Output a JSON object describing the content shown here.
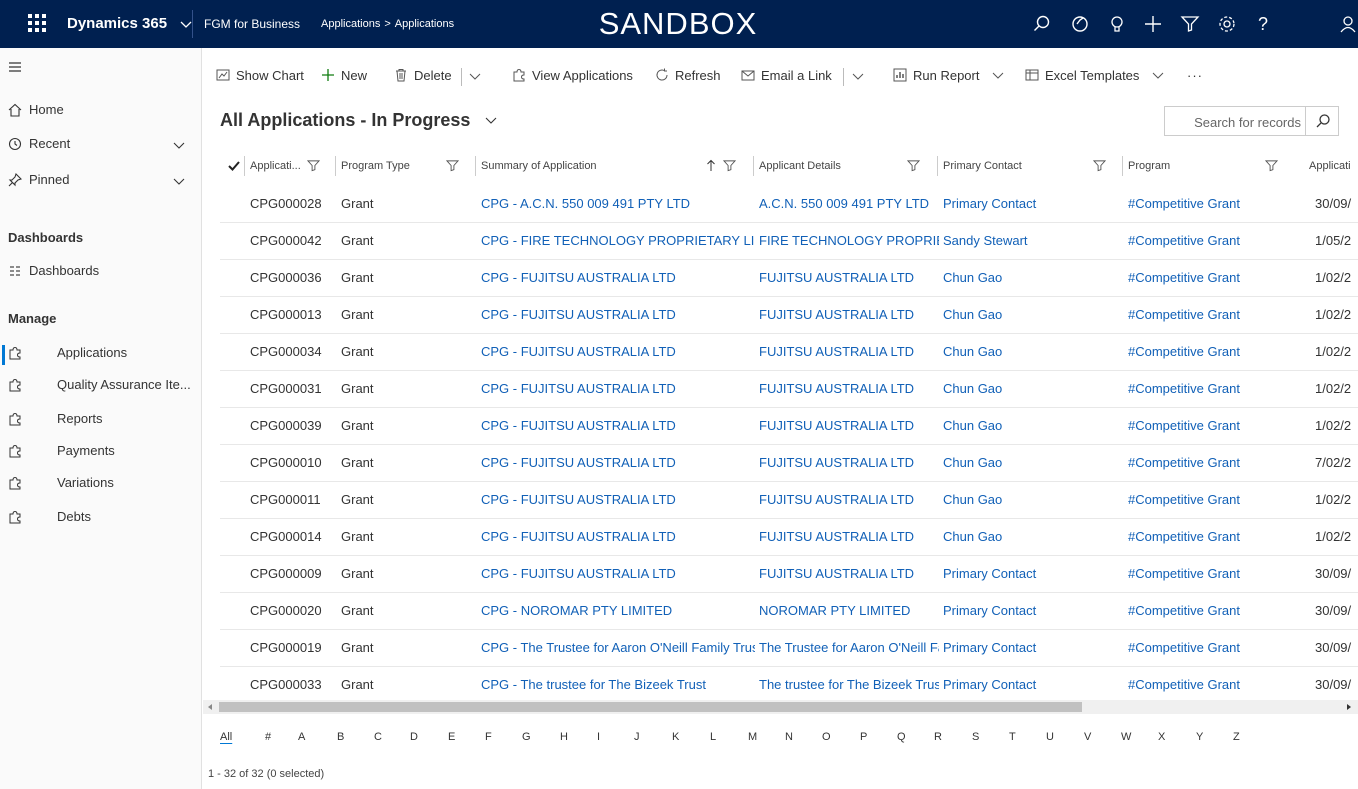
{
  "topbar": {
    "app_name": "Dynamics 365",
    "business_unit": "FGM for Business",
    "breadcrumb": [
      "Applications",
      "Applications"
    ],
    "environment_banner": "SANDBOX",
    "icons": [
      "search-icon",
      "activity-icon",
      "lightbulb-icon",
      "plus-icon",
      "filter-icon",
      "gear-icon",
      "help-icon",
      "user-icon"
    ],
    "background_color": "#002050"
  },
  "sidebar": {
    "top_items": [
      {
        "label": "Home",
        "icon": "home-icon"
      },
      {
        "label": "Recent",
        "icon": "clock-icon",
        "expandable": true
      },
      {
        "label": "Pinned",
        "icon": "pin-icon",
        "expandable": true
      }
    ],
    "sections": [
      {
        "title": "Dashboards",
        "items": [
          {
            "label": "Dashboards",
            "icon": "dashboard-icon"
          }
        ]
      },
      {
        "title": "Manage",
        "items": [
          {
            "label": "Applications",
            "icon": "puzzle-icon",
            "selected": true
          },
          {
            "label": "Quality Assurance Ite...",
            "icon": "puzzle-icon"
          },
          {
            "label": "Reports",
            "icon": "puzzle-icon"
          },
          {
            "label": "Payments",
            "icon": "puzzle-icon"
          },
          {
            "label": "Variations",
            "icon": "puzzle-icon"
          },
          {
            "label": "Debts",
            "icon": "puzzle-icon"
          }
        ]
      }
    ],
    "accent_color": "#0078d4"
  },
  "commands": [
    {
      "label": "Show Chart",
      "icon": "chart-icon"
    },
    {
      "label": "New",
      "icon": "plus-icon"
    },
    {
      "label": "Delete",
      "icon": "trash-icon"
    },
    {
      "label": "View Applications",
      "icon": "puzzle-icon"
    },
    {
      "label": "Refresh",
      "icon": "refresh-icon"
    },
    {
      "label": "Email a Link",
      "icon": "email-icon"
    },
    {
      "label": "Run Report",
      "icon": "report-icon"
    },
    {
      "label": "Excel Templates",
      "icon": "excel-icon"
    },
    {
      "label": "···",
      "icon": "more-icon"
    }
  ],
  "view": {
    "title": "All Applications - In Progress",
    "search_placeholder": "Search for records"
  },
  "grid": {
    "columns": [
      "Applicati...",
      "Program Type",
      "Summary of Application",
      "Applicant Details",
      "Primary Contact",
      "Program",
      "Applicati"
    ],
    "sorted_column": "Summary of Application",
    "sort_direction": "ascending",
    "rows": [
      [
        "CPG000028",
        "Grant",
        "CPG - A.C.N. 550 009 491 PTY LTD",
        "A.C.N. 550 009 491 PTY LTD",
        "Primary Contact",
        "#Competitive Grant",
        "30/09/"
      ],
      [
        "CPG000042",
        "Grant",
        "CPG - FIRE TECHNOLOGY PROPRIETARY LIMITE",
        "FIRE TECHNOLOGY PROPRIETA",
        "Sandy Stewart",
        "#Competitive Grant",
        "1/05/2"
      ],
      [
        "CPG000036",
        "Grant",
        "CPG - FUJITSU AUSTRALIA LTD",
        "FUJITSU AUSTRALIA LTD",
        "Chun Gao",
        "#Competitive Grant",
        "1/02/2"
      ],
      [
        "CPG000013",
        "Grant",
        "CPG - FUJITSU AUSTRALIA LTD",
        "FUJITSU AUSTRALIA LTD",
        "Chun Gao",
        "#Competitive Grant",
        "1/02/2"
      ],
      [
        "CPG000034",
        "Grant",
        "CPG - FUJITSU AUSTRALIA LTD",
        "FUJITSU AUSTRALIA LTD",
        "Chun Gao",
        "#Competitive Grant",
        "1/02/2"
      ],
      [
        "CPG000031",
        "Grant",
        "CPG - FUJITSU AUSTRALIA LTD",
        "FUJITSU AUSTRALIA LTD",
        "Chun Gao",
        "#Competitive Grant",
        "1/02/2"
      ],
      [
        "CPG000039",
        "Grant",
        "CPG - FUJITSU AUSTRALIA LTD",
        "FUJITSU AUSTRALIA LTD",
        "Chun Gao",
        "#Competitive Grant",
        "1/02/2"
      ],
      [
        "CPG000010",
        "Grant",
        "CPG - FUJITSU AUSTRALIA LTD",
        "FUJITSU AUSTRALIA LTD",
        "Chun Gao",
        "#Competitive Grant",
        "7/02/2"
      ],
      [
        "CPG000011",
        "Grant",
        "CPG - FUJITSU AUSTRALIA LTD",
        "FUJITSU AUSTRALIA LTD",
        "Chun Gao",
        "#Competitive Grant",
        "1/02/2"
      ],
      [
        "CPG000014",
        "Grant",
        "CPG - FUJITSU AUSTRALIA LTD",
        "FUJITSU AUSTRALIA LTD",
        "Chun Gao",
        "#Competitive Grant",
        "1/02/2"
      ],
      [
        "CPG000009",
        "Grant",
        "CPG - FUJITSU AUSTRALIA LTD",
        "FUJITSU AUSTRALIA LTD",
        "Primary Contact",
        "#Competitive Grant",
        "30/09/"
      ],
      [
        "CPG000020",
        "Grant",
        "CPG - NOROMAR PTY LIMITED",
        "NOROMAR PTY LIMITED",
        "Primary Contact",
        "#Competitive Grant",
        "30/09/"
      ],
      [
        "CPG000019",
        "Grant",
        "CPG - The Trustee for Aaron O'Neill Family Trust",
        "The Trustee for Aaron O'Neill Fa",
        "Primary Contact",
        "#Competitive Grant",
        "30/09/"
      ],
      [
        "CPG000033",
        "Grant",
        "CPG - The trustee for The Bizeek Trust",
        "The trustee for The Bizeek Trust",
        "Primary Contact",
        "#Competitive Grant",
        "30/09/"
      ]
    ],
    "link_color": "#1160b7"
  },
  "alpha_filter": {
    "letters": [
      "All",
      "#",
      "A",
      "B",
      "C",
      "D",
      "E",
      "F",
      "G",
      "H",
      "I",
      "J",
      "K",
      "L",
      "M",
      "N",
      "O",
      "P",
      "Q",
      "R",
      "S",
      "T",
      "U",
      "V",
      "W",
      "X",
      "Y",
      "Z"
    ],
    "active": "All"
  },
  "footer": {
    "record_count": "1 - 32 of 32 (0 selected)"
  }
}
